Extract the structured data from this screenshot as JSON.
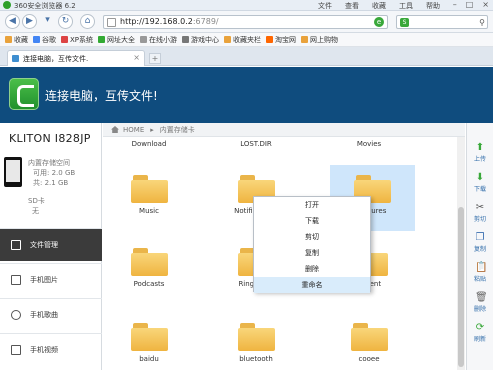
{
  "browser": {
    "title": "360安全浏览器 6.2",
    "menus": [
      "文件",
      "查看",
      "收藏",
      "工具",
      "帮助"
    ],
    "url": "http://192.168.0.2",
    "url_port": ":6789/",
    "bookmarks": [
      "收藏",
      "谷歌",
      "XP系统",
      "网址大全",
      "在线小游",
      "游戏中心",
      "收藏夹栏",
      "淘宝网",
      "网上购物"
    ],
    "tab_label": "连接电脑，互传文件."
  },
  "app": {
    "title": "连接电脑，互传文件!"
  },
  "sidebar": {
    "device": "KLITON I828JP",
    "storage_title": "内置存储空间",
    "storage_free": "可用: 2.0 GB",
    "storage_total": "共: 2.1 GB",
    "sd_title": "SD卡",
    "sd_value": "无",
    "nav": [
      "文件管理",
      "手机图片",
      "手机歌曲",
      "手机视频"
    ]
  },
  "breadcrumb": {
    "home": "HOME",
    "current": "内置存储卡"
  },
  "top_labels": [
    "Download",
    "LOST.DIR",
    "Movies"
  ],
  "folders": [
    {
      "name": "Music"
    },
    {
      "name": "Notifications"
    },
    {
      "name": "Pictures"
    },
    {
      "name": "Podcasts"
    },
    {
      "name": "Ringtones"
    },
    {
      "name": "Recent"
    },
    {
      "name": "baidu"
    },
    {
      "name": "bluetooth"
    },
    {
      "name": "cooee"
    }
  ],
  "context_menu": [
    "打开",
    "下载",
    "剪切",
    "复制",
    "删除",
    "重命名"
  ],
  "tools": [
    "上传",
    "下载",
    "剪切",
    "复制",
    "粘贴",
    "删除",
    "刷新"
  ],
  "colors": {
    "app_header": "#0f4c7e",
    "accent_green": "#39a83a",
    "selection": "#cfe6fb"
  }
}
